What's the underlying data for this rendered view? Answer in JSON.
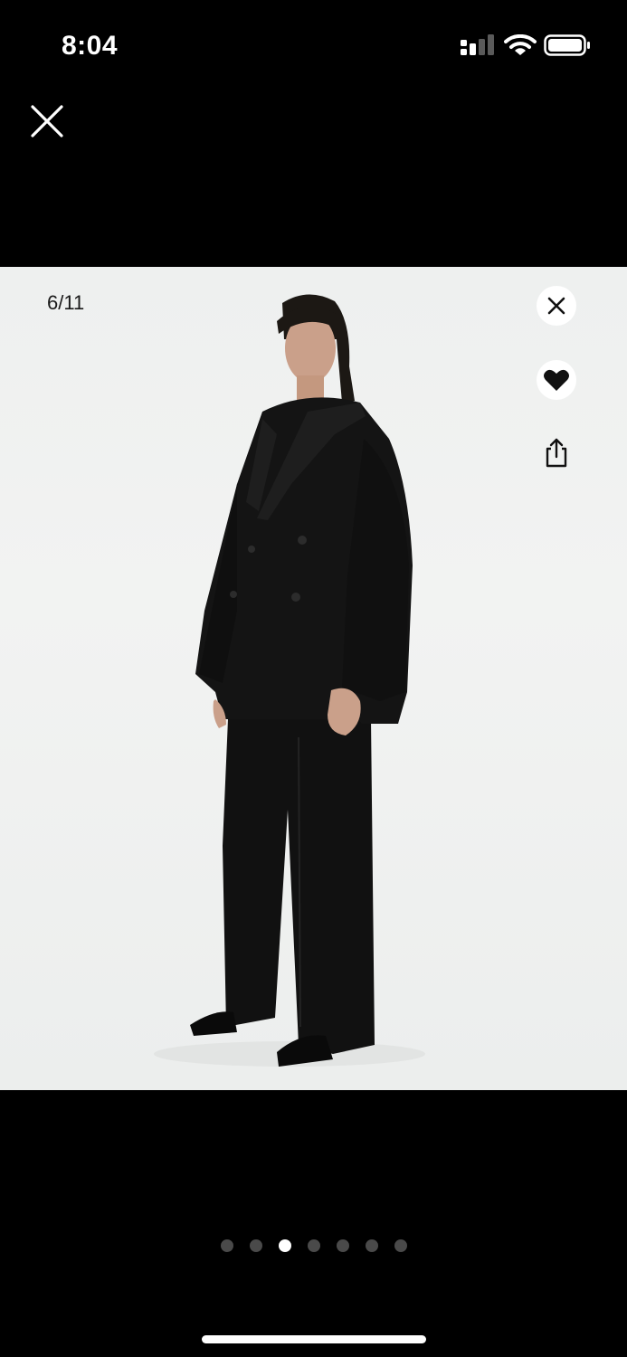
{
  "status_bar": {
    "time": "8:04",
    "icons": [
      "cellular-signal-icon",
      "wifi-icon",
      "battery-icon"
    ]
  },
  "viewer": {
    "close_icon": "close-icon"
  },
  "photo": {
    "counter": "6/11",
    "actions": [
      "close-icon",
      "heart-icon",
      "share-icon"
    ],
    "background": "#eff0ef"
  },
  "pager": {
    "total_dots": 7,
    "active_index": 2
  },
  "colors": {
    "chrome": "#000000",
    "icon_light": "#ffffff",
    "icon_dark": "#111111",
    "dot_inactive": "#4a4a4a"
  }
}
